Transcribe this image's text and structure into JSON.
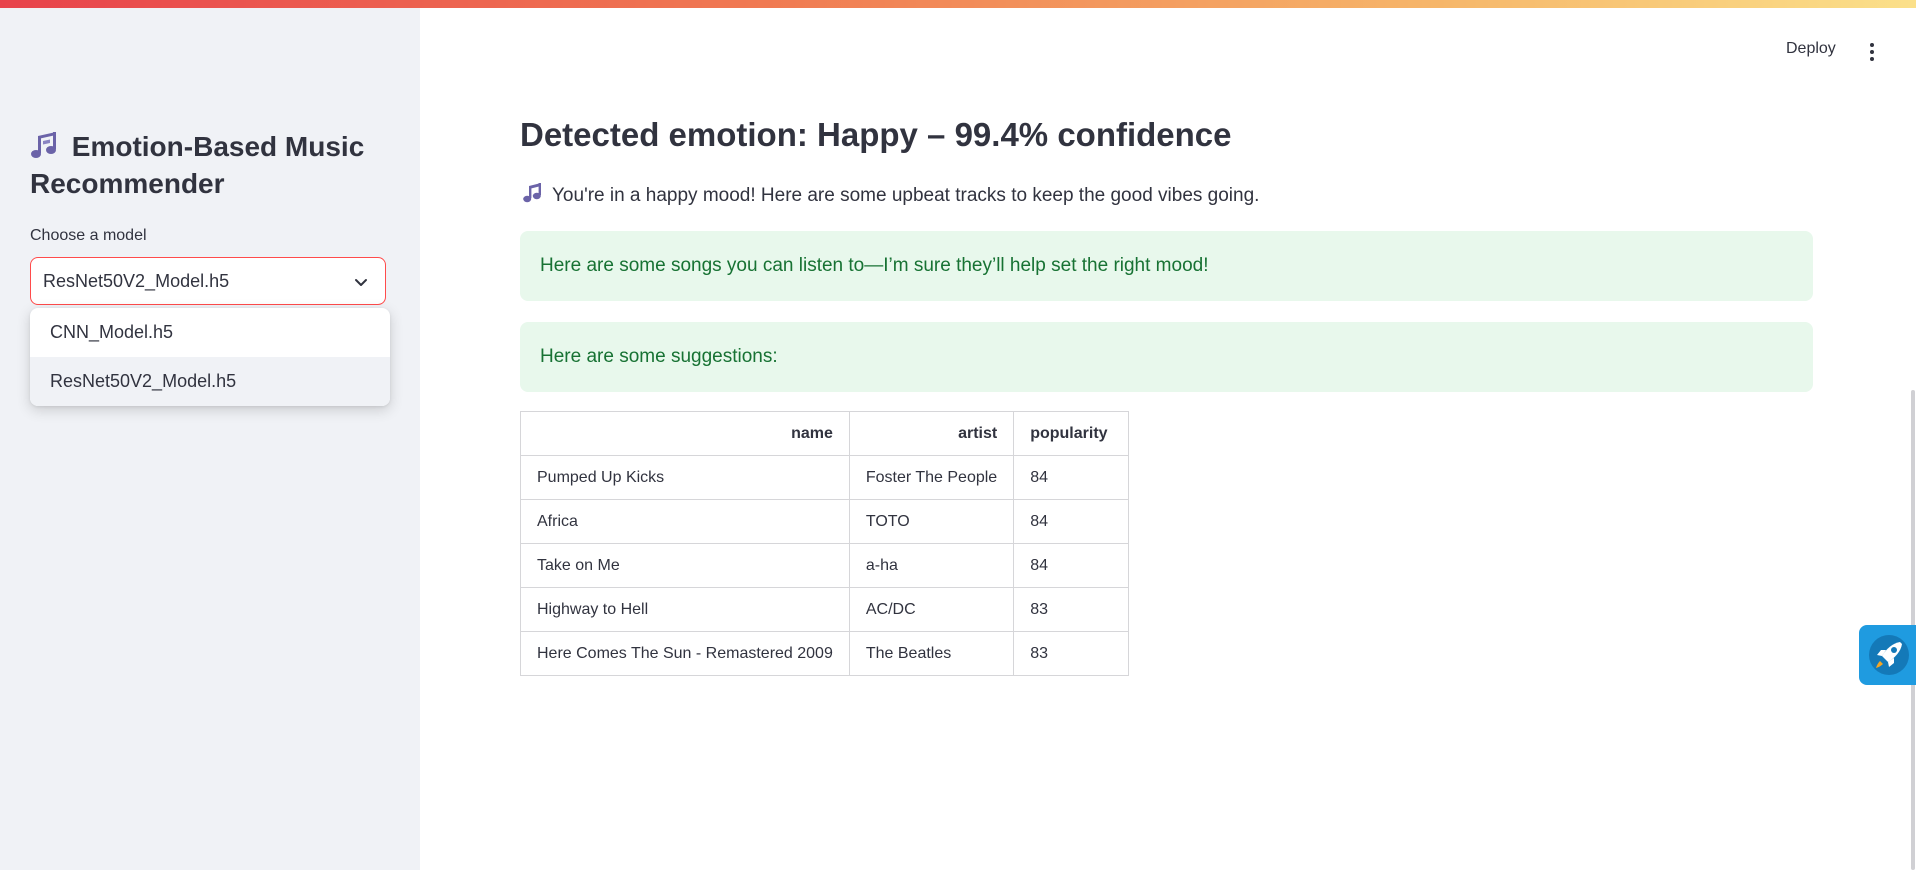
{
  "sidebar": {
    "title": "Emotion-Based Music Recommender",
    "model_label": "Choose a model",
    "selected_model": "ResNet50V2_Model.h5",
    "options": [
      "CNN_Model.h5",
      "ResNet50V2_Model.h5"
    ]
  },
  "header": {
    "deploy_label": "Deploy"
  },
  "main": {
    "heading": "Detected emotion: Happy – 99.4% confidence",
    "mood_text": "You're in a happy mood! Here are some upbeat tracks to keep the good vibes going.",
    "alert_1": "Here are some songs you can listen to—I’m sure they’ll help set the right mood!",
    "alert_2": "Here are some suggestions:"
  },
  "table": {
    "headers": [
      "name",
      "artist",
      "popularity"
    ],
    "rows": [
      [
        "Pumped Up Kicks",
        "Foster The People",
        "84"
      ],
      [
        "Africa",
        "TOTO",
        "84"
      ],
      [
        "Take on Me",
        "a-ha",
        "84"
      ],
      [
        "Highway to Hell",
        "AC/DC",
        "83"
      ],
      [
        "Here Comes The Sun - Remastered 2009",
        "The Beatles",
        "83"
      ]
    ]
  },
  "colors": {
    "accent": "#ff4b4b",
    "success_bg": "#e8f8ec",
    "success_text": "#177233",
    "sidebar_bg": "#f0f2f6",
    "icon_purple": "#6b63a8",
    "rocket_bg": "#1f9be0"
  },
  "icons": [
    "music-notes-icon",
    "music-note-icon",
    "chevron-down-icon",
    "kebab-menu-icon",
    "rocket-icon"
  ]
}
